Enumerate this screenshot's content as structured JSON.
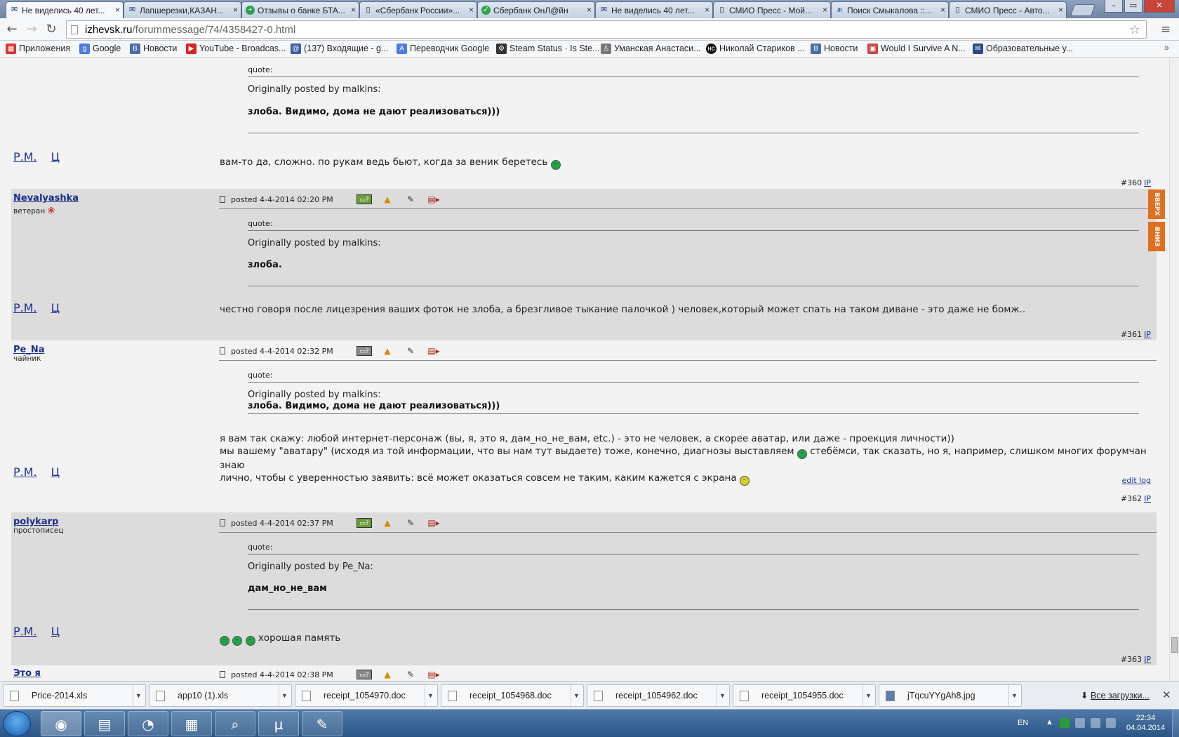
{
  "browser": {
    "tabs": [
      {
        "title": "Не виделись 40 лет...",
        "icon": "mail-icon",
        "active": true
      },
      {
        "title": "Лапшерезки,КАЗАН...",
        "icon": "mail-icon"
      },
      {
        "title": "Отзывы о банке БТА...",
        "icon": "plus-icon"
      },
      {
        "title": "«Сбербанк России»...",
        "icon": "page-icon"
      },
      {
        "title": "Сбербанк ОнЛ@йн",
        "icon": "sberbank-icon"
      },
      {
        "title": "Не виделись 40 лет...",
        "icon": "mail-icon"
      },
      {
        "title": "СМИО Пресс - Мой...",
        "icon": "page-icon"
      },
      {
        "title": "Поиск Смыкалова ::...",
        "icon": "butterfly-icon"
      },
      {
        "title": "СМИО Пресс - Авто...",
        "icon": "page-icon"
      }
    ],
    "url_domain": "izhevsk.ru",
    "url_path": "/forummessage/74/4358427-0.html",
    "bookmarks": [
      {
        "label": "Приложения",
        "icon": "apps-icon",
        "color": "#d33"
      },
      {
        "label": "Google",
        "icon": "google-icon",
        "color": "#4a7de0"
      },
      {
        "label": "Новости",
        "icon": "vk-icon",
        "color": "#4a6ea8"
      },
      {
        "label": "YouTube - Broadcas...",
        "icon": "youtube-icon",
        "color": "#d22"
      },
      {
        "label": "(137) Входящие - g...",
        "icon": "mail-icon",
        "color": "#3a5ea0"
      },
      {
        "label": "Переводчик Google",
        "icon": "translate-icon",
        "color": "#4a7de0"
      },
      {
        "label": "Steam Status · Is Ste...",
        "icon": "gear-icon",
        "color": "#333"
      },
      {
        "label": "Уманская Анастаси...",
        "icon": "person-icon",
        "color": "#666"
      },
      {
        "label": "Николай Стариков ...",
        "icon": "hc-icon",
        "color": "#111"
      },
      {
        "label": "Новости",
        "icon": "vk-icon",
        "color": "#4a6ea8"
      },
      {
        "label": "Would I Survive A N...",
        "icon": "photo-icon",
        "color": "#c44"
      },
      {
        "label": "Образовательные у...",
        "icon": "mail-icon",
        "color": "#2c4a86"
      }
    ]
  },
  "forum": {
    "rm_label": "Р.М.",
    "c_label": "Ц",
    "quote_label": "quote:",
    "posts": [
      {
        "quote_by": "Originally posted by malkins:",
        "quote_text": "злоба. Видимо, дома не дают реализоваться)))",
        "body": "вам-то да, сложно. по рукам ведь бьют, когда за веник беретесь",
        "number": "#360",
        "ip": "IP"
      },
      {
        "nick": "Nevalyashka",
        "rank": "ветеран",
        "posted": "posted 4-4-2014 02:20 PM",
        "quote_by": "Originally posted by malkins:",
        "quote_text": "злоба.",
        "body": "честно говоря после лицезрения ваших фоток не злоба, а брезгливое тыкание палочкой ) человек,который может спать на таком диване - это даже не бомж..",
        "number": "#361",
        "ip": "IP"
      },
      {
        "nick": "Pe_Na",
        "rank": "чайник",
        "posted": "posted 4-4-2014 02:32 PM",
        "quote_by": "Originally posted by malkins:",
        "quote_text": "злоба. Видимо, дома не дают реализоваться)))",
        "body_line1": "я вам так скажу: любой интернет-персонаж (вы, я, это я, дам_но_не_вам, etc.) - это не человек, а скорее аватар, или даже - проекция личности))",
        "body_line2a": "мы вашему \"аватару\" (исходя из той информации, что вы нам тут выдаете) тоже, конечно, диагнозы выставляем",
        "body_line2b": "стебёмси, так сказать, но я, например, слишком многих форумчан знаю",
        "body_line3": "лично, чтобы с уверенностью заявить: всё может оказаться совсем не таким, каким кажется с экрана",
        "edit_log": "edit log",
        "number": "#362",
        "ip": "IP"
      },
      {
        "nick": "polykarp",
        "rank": "простописец",
        "posted": "posted 4-4-2014 02:37 PM",
        "quote_by": "Originally posted by Pe_Na:",
        "quote_text": "дам_но_не_вам",
        "body": "хорошая память",
        "number": "#363",
        "ip": "IP"
      },
      {
        "nick": "Это я",
        "posted": "posted 4-4-2014 02:38 PM"
      }
    ],
    "side_up": "ВВЕРХ",
    "side_down": "ВНИЗ"
  },
  "downloads": {
    "items": [
      "Price-2014.xls",
      "app10 (1).xls",
      "receipt_1054970.doc",
      "receipt_1054968.doc",
      "receipt_1054962.doc",
      "receipt_1054955.doc",
      "jTqcuYYgAh8.jpg"
    ],
    "all_label": "Все загрузки..."
  },
  "taskbar": {
    "lang": "EN",
    "time": "22:34",
    "date": "04.04.2014"
  }
}
